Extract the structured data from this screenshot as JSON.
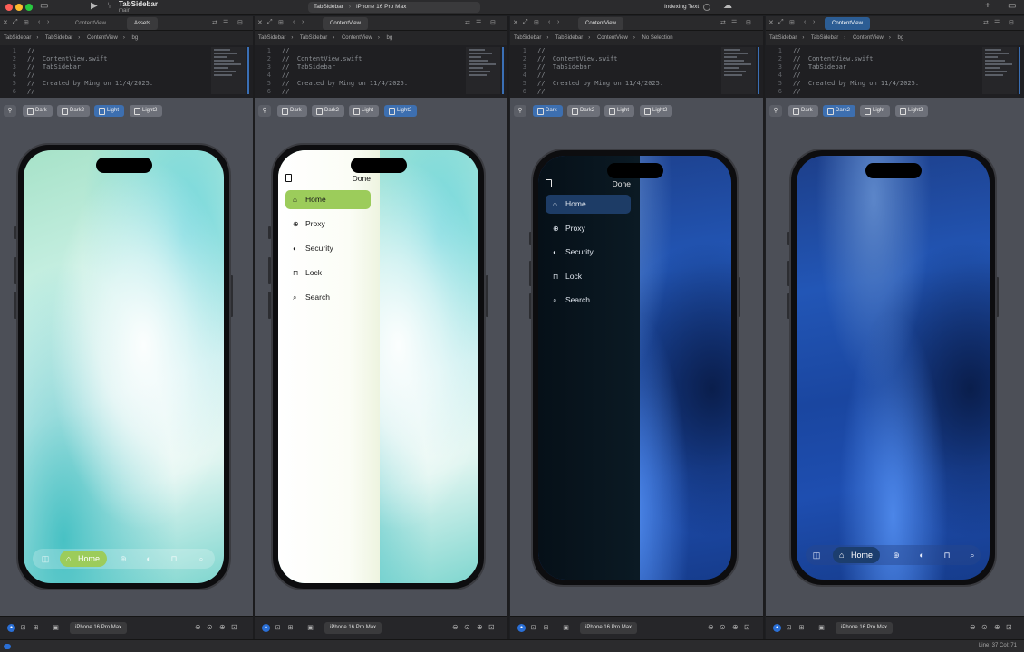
{
  "titlebar": {
    "project": "TabSidebar",
    "branch": "main",
    "scheme_target": "TabSidebar",
    "scheme_device": "iPhone 16 Pro Max",
    "activity": "Indexing Text"
  },
  "code_lines": [
    {
      "n": "1",
      "t": "//"
    },
    {
      "n": "2",
      "t": "//  ContentView.swift"
    },
    {
      "n": "3",
      "t": "//  TabSidebar"
    },
    {
      "n": "4",
      "t": "//"
    },
    {
      "n": "5",
      "t": "//  Created by Ming on 11/4/2025."
    },
    {
      "n": "6",
      "t": "//"
    }
  ],
  "panes": [
    {
      "tabs": [
        "ContentView",
        "Assets"
      ],
      "crumbs": [
        "TabSidebar",
        "TabSidebar",
        "ContentView",
        "bg"
      ],
      "pills": [
        "Dark",
        "Dark2",
        "Light",
        "Light2"
      ],
      "active_pill": 2,
      "device": "iPhone 16 Pro Max"
    },
    {
      "tabs": [
        "ContentView"
      ],
      "crumbs": [
        "TabSidebar",
        "TabSidebar",
        "ContentView",
        "bg"
      ],
      "pills": [
        "Dark",
        "Dark2",
        "Light",
        "Light2"
      ],
      "active_pill": 3,
      "device": "iPhone 16 Pro Max"
    },
    {
      "tabs": [
        "ContentView"
      ],
      "crumbs": [
        "TabSidebar",
        "TabSidebar",
        "ContentView",
        "No Selection"
      ],
      "pills": [
        "Dark",
        "Dark2",
        "Light",
        "Light2"
      ],
      "active_pill": 0,
      "device": "iPhone 16 Pro Max"
    },
    {
      "tabs": [
        "ContentView"
      ],
      "crumbs": [
        "TabSidebar",
        "TabSidebar",
        "ContentView",
        "bg"
      ],
      "pills": [
        "Dark",
        "Dark2",
        "Light",
        "Light2"
      ],
      "active_pill": 1,
      "device": "iPhone 16 Pro Max"
    }
  ],
  "tabbar": {
    "home_label": "Home",
    "icons": [
      "sidebar-icon",
      "home-icon",
      "network-icon",
      "security-icon",
      "lock-icon",
      "search-icon"
    ]
  },
  "sidebar": {
    "done_label": "Done",
    "items": [
      {
        "label": "Home",
        "icon": "house"
      },
      {
        "label": "Proxy",
        "icon": "network"
      },
      {
        "label": "Security",
        "icon": "half-circle"
      },
      {
        "label": "Lock",
        "icon": "lock"
      },
      {
        "label": "Search",
        "icon": "magnifier"
      }
    ]
  },
  "status": {
    "line_col": "Line: 37  Col: 71"
  },
  "colors": {
    "light_accent": "#9ccc5b",
    "dark_accent": "#1d3c66",
    "pill_active": "#3d6fb0",
    "xcode_blue": "#2a6fd6"
  }
}
